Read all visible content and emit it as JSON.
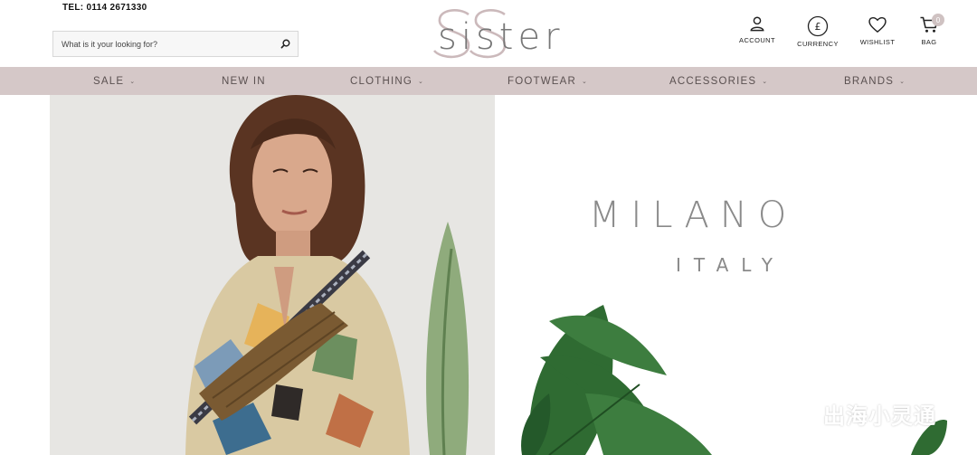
{
  "header": {
    "telephone": "TEL: 0114 2671330",
    "search_placeholder": "What is it your looking for?",
    "logo_text": "sister"
  },
  "utility_nav": {
    "account": "ACCOUNT",
    "currency": "CURRENCY",
    "currency_symbol": "£",
    "wishlist": "WISHLIST",
    "bag": "BAG",
    "bag_count": "0"
  },
  "main_nav": [
    {
      "label": "SALE",
      "has_dropdown": true
    },
    {
      "label": "NEW IN",
      "has_dropdown": false
    },
    {
      "label": "CLOTHING",
      "has_dropdown": true
    },
    {
      "label": "FOOTWEAR",
      "has_dropdown": true
    },
    {
      "label": "ACCESSORIES",
      "has_dropdown": true
    },
    {
      "label": "BRANDS",
      "has_dropdown": true
    }
  ],
  "promo": {
    "brand": "MILANO",
    "subtitle": "ITALY"
  },
  "watermark": {
    "text": "出海小灵通"
  },
  "colors": {
    "nav_background": "#d5c8c8",
    "logo_circle": "#cbb9bb",
    "nav_text": "#5a5050"
  }
}
